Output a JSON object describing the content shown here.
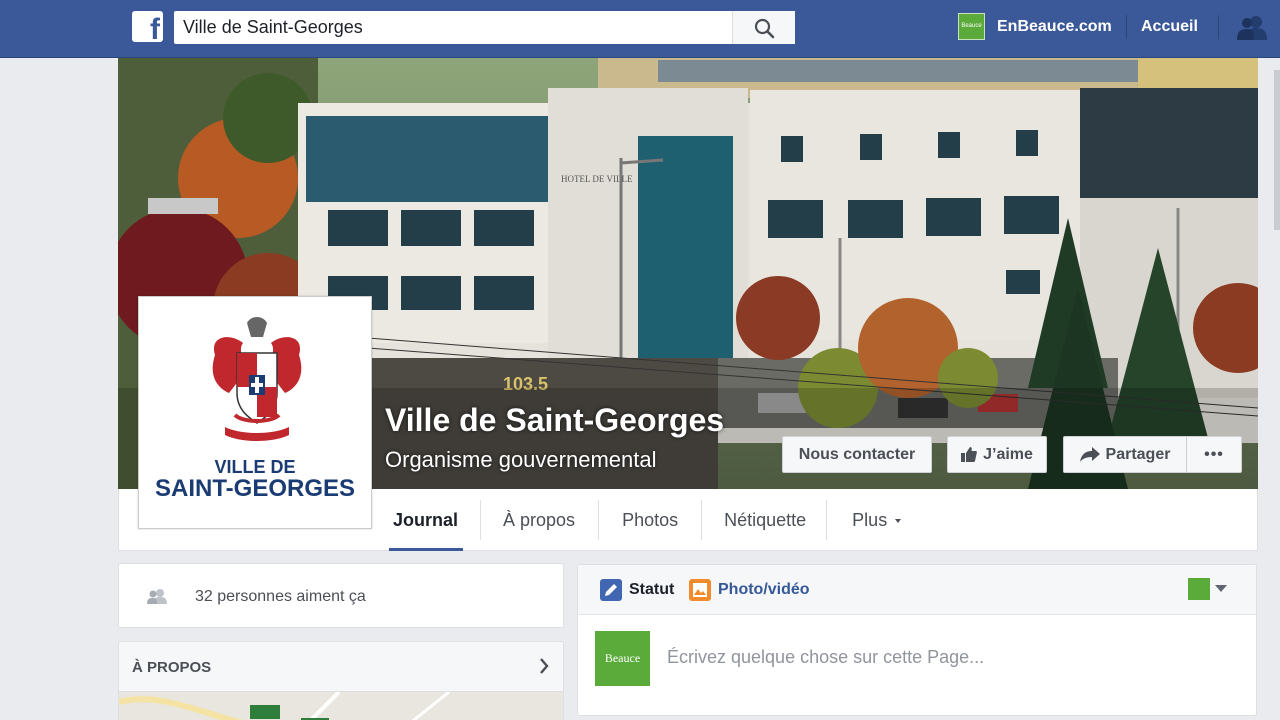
{
  "topbar": {
    "logo_letter": "f",
    "search_value": "Ville de Saint-Georges",
    "site_link": "EnBeauce.com",
    "home_link": "Accueil",
    "thumb_text": "Beauce"
  },
  "page": {
    "name": "Ville de Saint-Georges",
    "category": "Organisme gouvernemental",
    "profile_line1": "VILLE DE",
    "profile_line2": "SAINT-GEORGES"
  },
  "cover_actions": {
    "contact": "Nous contacter",
    "like": "J’aime",
    "share": "Partager",
    "more": "•••"
  },
  "tabs": [
    {
      "label": "Journal"
    },
    {
      "label": "À propos"
    },
    {
      "label": "Photos"
    },
    {
      "label": "Nétiquette"
    },
    {
      "label": "Plus"
    }
  ],
  "left": {
    "likes_text": "32 personnes aiment ça",
    "about_title": "À PROPOS"
  },
  "composer": {
    "status_label": "Statut",
    "photo_label": "Photo/vidéo",
    "avatar_text": "Beauce",
    "placeholder": "Écrivez quelque chose sur cette Page..."
  },
  "cover_scene": {
    "building_sign": "HOTEL DE VILLE",
    "radio_sign": "103.5"
  },
  "colors": {
    "brand": "#3b5998",
    "green": "#5bab3b"
  }
}
